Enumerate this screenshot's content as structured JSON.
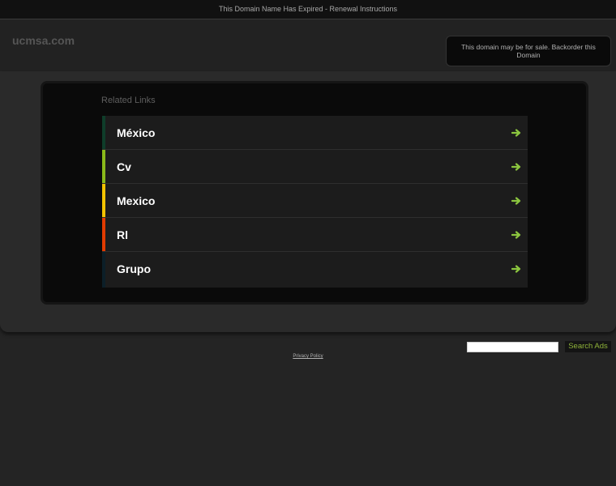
{
  "topbar": {
    "text": "This Domain Name Has Expired - Renewal Instructions"
  },
  "header": {
    "domain": "ucmsa.com",
    "sale_text": "This domain may be for sale. Backorder this Domain"
  },
  "related": {
    "title": "Related Links",
    "items": [
      {
        "label": "México",
        "color": "#0f3d2a"
      },
      {
        "label": "Cv",
        "color": "#8ab91a"
      },
      {
        "label": "Mexico",
        "color": "#f2c200"
      },
      {
        "label": "Rl",
        "color": "#e23b00"
      },
      {
        "label": "Grupo",
        "color": "#0c1f28"
      }
    ],
    "arrow_icon": "right-arrow-icon",
    "arrow_color": "#8cc63f"
  },
  "search": {
    "input_value": "",
    "button_label": "Search Ads"
  },
  "footer": {
    "privacy_label": "Privacy Policy"
  }
}
